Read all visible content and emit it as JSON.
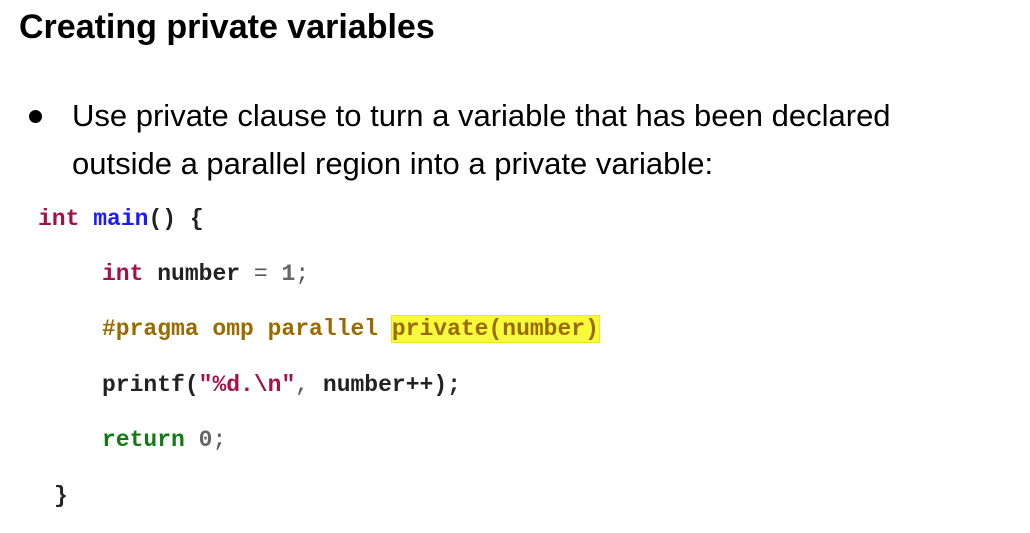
{
  "slide": {
    "title": "Creating private variables",
    "bullet": {
      "line1": "Use private clause to turn a variable that has been declared",
      "line2": "outside a parallel region into a private variable:"
    }
  },
  "code": {
    "line1": {
      "type": "int",
      "fn": "main",
      "rest": "() {"
    },
    "line2": {
      "type": "int",
      "name": "number",
      "op": "=",
      "value": "1",
      "end": ";"
    },
    "line3": {
      "directive": "#pragma omp parallel",
      "clause": "private(number)"
    },
    "line4": {
      "fn": "printf",
      "open": "(",
      "str": "\"%d.\\n\"",
      "comma": ",",
      "arg": "number++",
      "close": ");"
    },
    "line5": {
      "kw": "return",
      "value": "0",
      "end": ";"
    },
    "line6": {
      "brace": "}"
    }
  },
  "colors": {
    "type_keyword": "#a0124a",
    "function_name": "#1a1aff",
    "return_keyword": "#127a12",
    "preprocessor": "#9a6a00",
    "highlight": "#f7fb3a"
  }
}
